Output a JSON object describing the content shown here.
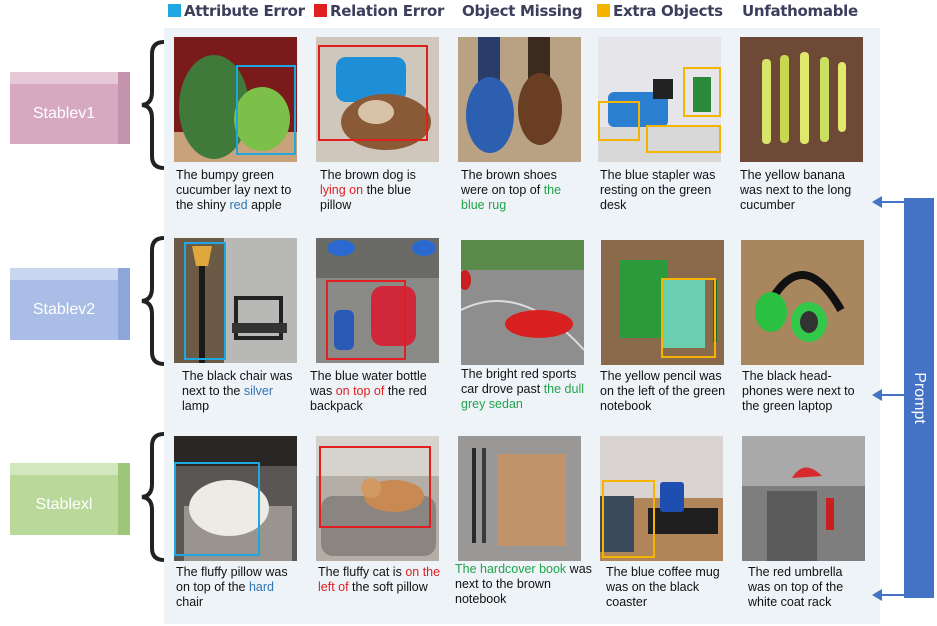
{
  "legend": [
    {
      "label": "Attribute Error",
      "swatch": "#1fa7e1"
    },
    {
      "label": "Relation Error",
      "swatch": "#e02020"
    },
    {
      "label": "Object Missing",
      "swatch": ""
    },
    {
      "label": "Extra Objects",
      "swatch": "#f5b400"
    },
    {
      "label": "Unfathomable",
      "swatch": ""
    }
  ],
  "models": [
    "Stablev1",
    "Stablev2",
    "Stablexl"
  ],
  "prompt_label": "Prompt",
  "captions": {
    "r0c0": {
      "a": "The bumpy green cucumber lay next to the shiny ",
      "h": "red",
      "b": " apple"
    },
    "r0c1": {
      "a": "The brown dog is ",
      "h": "lying on",
      "b": " the blue pillow"
    },
    "r0c2": {
      "a": "The brown shoes were on top of ",
      "h": "the blue rug",
      "b": ""
    },
    "r0c3": {
      "a": "The blue stapler was resting on the green desk",
      "h": "",
      "b": ""
    },
    "r0c4": {
      "a": "The yellow banana was next to the long cucumber",
      "h": "",
      "b": ""
    },
    "r1c0": {
      "a": "The black chair was next to the ",
      "h": "silver",
      "b": " lamp"
    },
    "r1c1": {
      "a": "The blue water bottle was ",
      "h": "on top of",
      "b": " the red backpack"
    },
    "r1c2": {
      "a": "The bright red sports car drove past ",
      "h": "the dull grey sedan",
      "b": ""
    },
    "r1c3": {
      "a": "The yellow pencil was on the left of the green notebook",
      "h": "",
      "b": ""
    },
    "r1c4": {
      "a": "The black head-phones were next to the green laptop",
      "h": "",
      "b": ""
    },
    "r2c0": {
      "a": "The fluffy  pillow was on top of the ",
      "h": "hard",
      "b": " chair"
    },
    "r2c1": {
      "a": "The fluffy  cat is ",
      "h": "on the left of",
      "b": " the soft pillow"
    },
    "r2c2": {
      "a": "",
      "h": "The hardcover book",
      "b": " was next to the brown notebook"
    },
    "r2c3": {
      "a": "The blue coffee mug was on the black coaster",
      "h": "",
      "b": ""
    },
    "r2c4": {
      "a": "The red umbrella was on top of the white coat rack",
      "h": "",
      "b": ""
    }
  },
  "colors": {
    "attribute": "#1fa7e1",
    "relation": "#e02020",
    "extra": "#f5b400",
    "prompt": "#4472c4",
    "stablev1": "#d6a9c0",
    "stablev2": "#a9bde6",
    "stablexl": "#b9d99a"
  }
}
